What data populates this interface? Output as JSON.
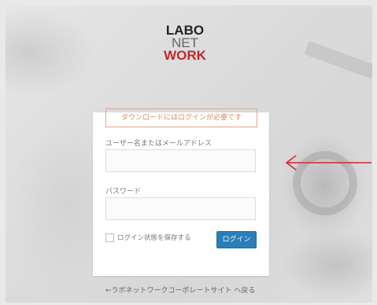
{
  "logo": {
    "line1": "LABO",
    "line2": "NET",
    "line3": "WORK"
  },
  "notice": "ダウンロードにはログインが必要です",
  "username": {
    "label": "ユーザー名またはメールアドレス",
    "value": ""
  },
  "password": {
    "label": "パスワード",
    "value": ""
  },
  "remember_label": "ログイン状態を保存する",
  "login_button": "ログイン",
  "back_link": "←ラボネットワークコーポレートサイト へ戻る",
  "colors": {
    "accent": "#2a7fb8",
    "logo_red": "#c1272d",
    "notice": "#d98a64",
    "arrow": "#d9232a"
  }
}
